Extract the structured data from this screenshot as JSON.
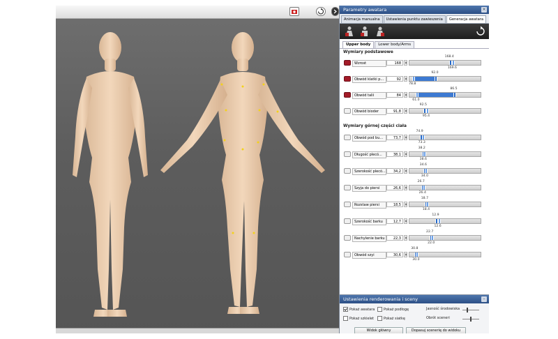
{
  "panel": {
    "title": "Parametry awatara",
    "tabs": [
      "Animacja manualna",
      "Ustawienia punktu zawieszenia",
      "Generacja awatara"
    ],
    "active_tab": 2,
    "subtabs": [
      "Upper body",
      "Lower body/Arms"
    ],
    "active_subtab": 0
  },
  "sections": {
    "basic": {
      "title": "Wymiary podstawowe",
      "rows": [
        {
          "label": "Wzrost",
          "value": "168",
          "locked": true,
          "top_num": "168.4",
          "bot_num": "169.6",
          "fill": [
            0,
            0
          ],
          "m1": 0.56,
          "m2": 0.6
        },
        {
          "label": "Obwód klatki p...",
          "value": "92",
          "locked": true,
          "top_num": "92.0",
          "bot_num": "78.8",
          "fill": [
            0.05,
            0.36
          ],
          "m1": 0.36,
          "m2": 0.05
        },
        {
          "label": "Obwód talii",
          "value": "84",
          "locked": true,
          "top_num": "86.5",
          "bot_num": "61.0",
          "fill": [
            0.1,
            0.62
          ],
          "m1": 0.62,
          "m2": 0.1
        },
        {
          "label": "Obwód bioder",
          "value": "91,8",
          "locked": false,
          "top_num": "92.5",
          "bot_num": "95.4",
          "fill": [
            0,
            0
          ],
          "m1": 0.2,
          "m2": 0.24
        }
      ]
    },
    "upper": {
      "title": "Wymiary górnej części ciała",
      "rows": [
        {
          "label": "Obwód pod bu...",
          "value": "73,7",
          "locked": false,
          "top_num": "74.9",
          "bot_num": "73.3",
          "fill": [
            0,
            0
          ],
          "m1": 0.15,
          "m2": 0.18
        },
        {
          "label": "Długość plecó...",
          "value": "38,1",
          "locked": false,
          "top_num": "38.2",
          "bot_num": "38.6",
          "fill": [
            0,
            0
          ],
          "m1": 0.18,
          "m2": 0.2
        },
        {
          "label": "Szerokość plecó...",
          "value": "34,2",
          "locked": false,
          "top_num": "34.6",
          "bot_num": "34.0",
          "fill": [
            0,
            0
          ],
          "m1": 0.2,
          "m2": 0.22
        },
        {
          "label": "Szyja do piersi",
          "value": "26,6",
          "locked": false,
          "top_num": "26.7",
          "bot_num": "26.4",
          "fill": [
            0,
            0
          ],
          "m1": 0.17,
          "m2": 0.19
        },
        {
          "label": "Rozstaw piersi",
          "value": "18,5",
          "locked": false,
          "top_num": "18.7",
          "bot_num": "18.4",
          "fill": [
            0,
            0
          ],
          "m1": 0.22,
          "m2": 0.24
        },
        {
          "label": "Szerokość barku",
          "value": "12,7",
          "locked": false,
          "top_num": "12.9",
          "bot_num": "12.6",
          "fill": [
            0,
            0
          ],
          "m1": 0.37,
          "m2": 0.4
        },
        {
          "label": "Nachylenie barku",
          "value": "22,3",
          "locked": false,
          "top_num": "22.7",
          "bot_num": "22.0",
          "fill": [
            0,
            0
          ],
          "m1": 0.29,
          "m2": 0.31
        },
        {
          "label": "Obwód szyi",
          "value": "30,6",
          "locked": false,
          "top_num": "30.8",
          "bot_num": "30.0",
          "fill": [
            0,
            0
          ],
          "m1": 0.08,
          "m2": 0.1
        }
      ]
    }
  },
  "bottom": {
    "title": "Ustawienia renderowania i sceny",
    "options": [
      {
        "label": "Pokaż awatara",
        "checked": true
      },
      {
        "label": "Pokaż podłogę",
        "checked": false
      },
      {
        "label": "Pokaż szkielet",
        "checked": false
      },
      {
        "label": "Pokaż siatkę",
        "checked": false
      }
    ],
    "slider1_label": "Jasność środowiska",
    "slider2_label": "Obrót sceneri",
    "slider1_value": 0.3,
    "slider2_value": 0.5,
    "btn1": "Widok główny",
    "btn2": "Dopasuj scenerię do widoku"
  },
  "colors": {
    "accent": "#3d7ad2",
    "lock": "#a31b28",
    "title": "#2c4f85"
  }
}
